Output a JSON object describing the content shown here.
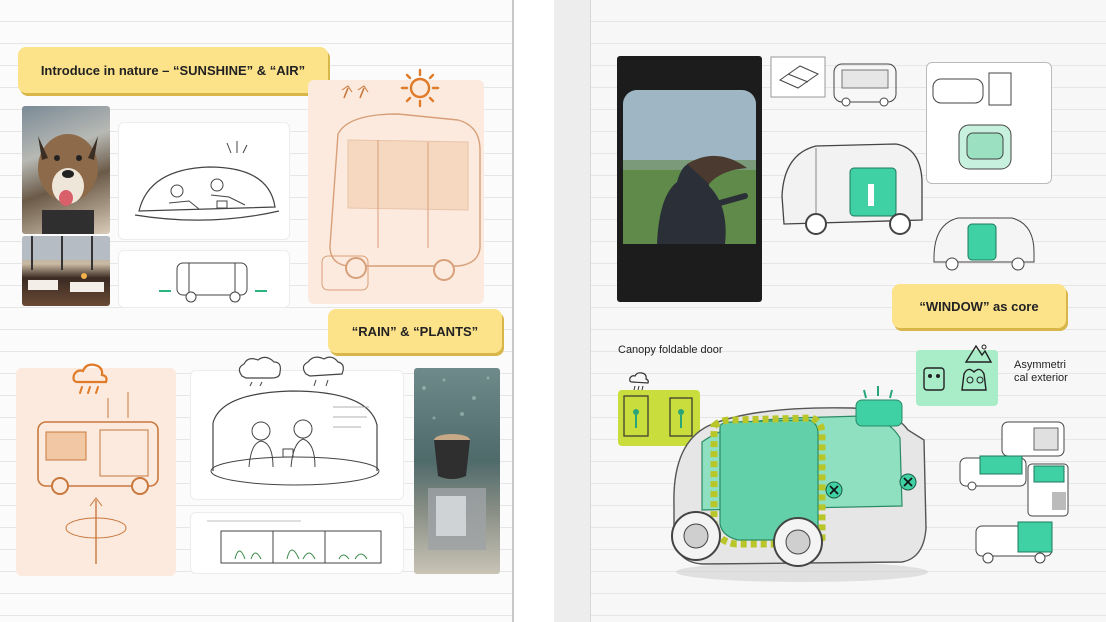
{
  "left": {
    "note_sunshine": "Introduce in nature – “SUNSHINE” & “AIR”",
    "note_rain": "“RAIN” & “PLANTS”"
  },
  "right": {
    "note_window": "“WINDOW” as core",
    "label_canopy": "Canopy foldable door",
    "label_asym": "Asymmetri\ncal exterior"
  },
  "colors": {
    "sticky": "#fce38a",
    "accent_orange": "#e07b2a",
    "accent_green": "#3fd0a3",
    "accent_lime": "#c9dd3c",
    "peach_card": "#fbeadd"
  },
  "icons": [
    "sun-icon",
    "rain-cloud-icon",
    "clouds-icon",
    "mountain-icon",
    "robot-icon",
    "people-icon",
    "arrow-up-icon"
  ]
}
